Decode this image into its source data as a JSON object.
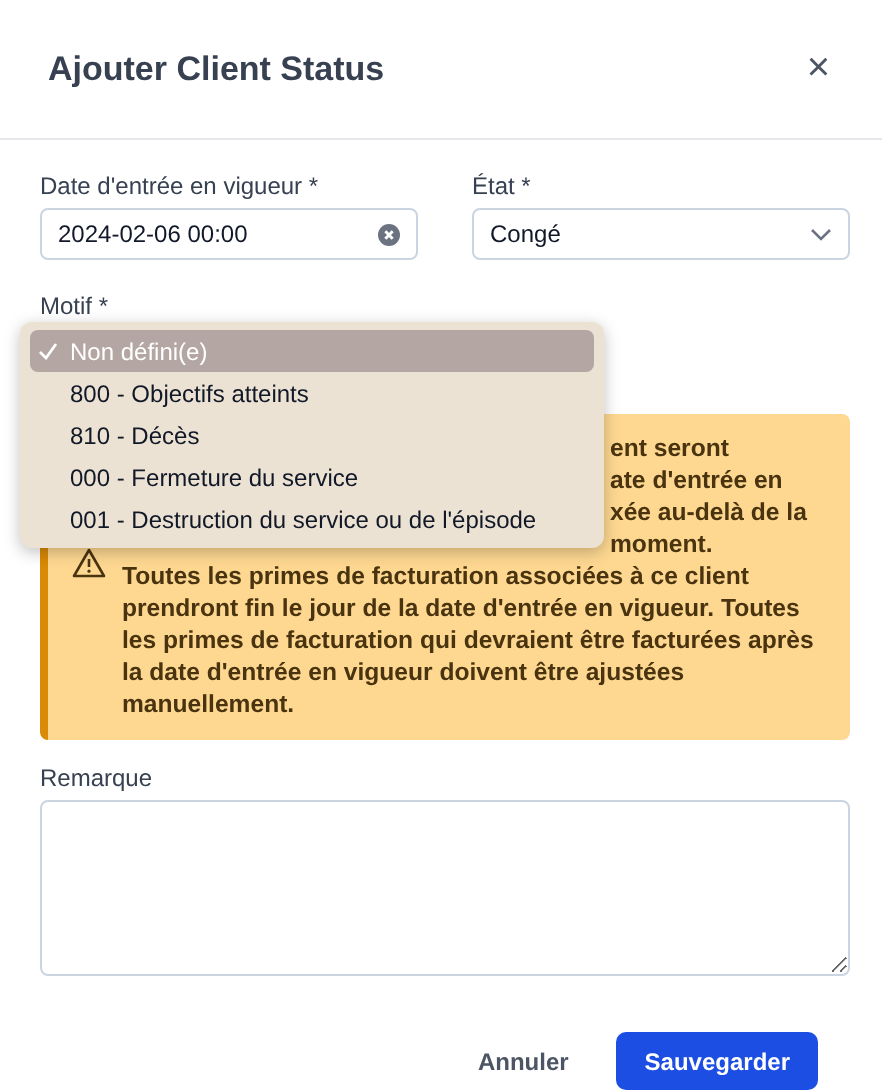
{
  "dialog": {
    "title": "Ajouter Client Status",
    "close": "×"
  },
  "date_field": {
    "label": "Date d'entrée en vigueur *",
    "value": "2024-02-06 00:00"
  },
  "state_field": {
    "label": "État *",
    "value": "Congé"
  },
  "reason_field": {
    "label": "Motif *",
    "expanded": true,
    "options": [
      {
        "label": "Non défini(e)",
        "selected": true
      },
      {
        "label": "800 - Objectifs atteints",
        "selected": false
      },
      {
        "label": "810 - Décès",
        "selected": false
      },
      {
        "label": "000 - Fermeture du service",
        "selected": false
      },
      {
        "label": "001 - Destruction du service ou de l'épisode",
        "selected": false
      }
    ]
  },
  "warning": {
    "visible_fragments": [
      "ent seront",
      "ate d'entrée en",
      "xée au-delà de la",
      "moment."
    ],
    "text": "Toutes les primes de facturation associées à ce client prendront fin le jour de la date d'entrée en vigueur. Toutes les primes de facturation qui devraient être facturées après la date d'entrée en vigueur doivent être ajustées manuellement."
  },
  "note_field": {
    "label": "Remarque"
  },
  "buttons": {
    "cancel": "Annuler",
    "save": "Sauvegarder"
  }
}
